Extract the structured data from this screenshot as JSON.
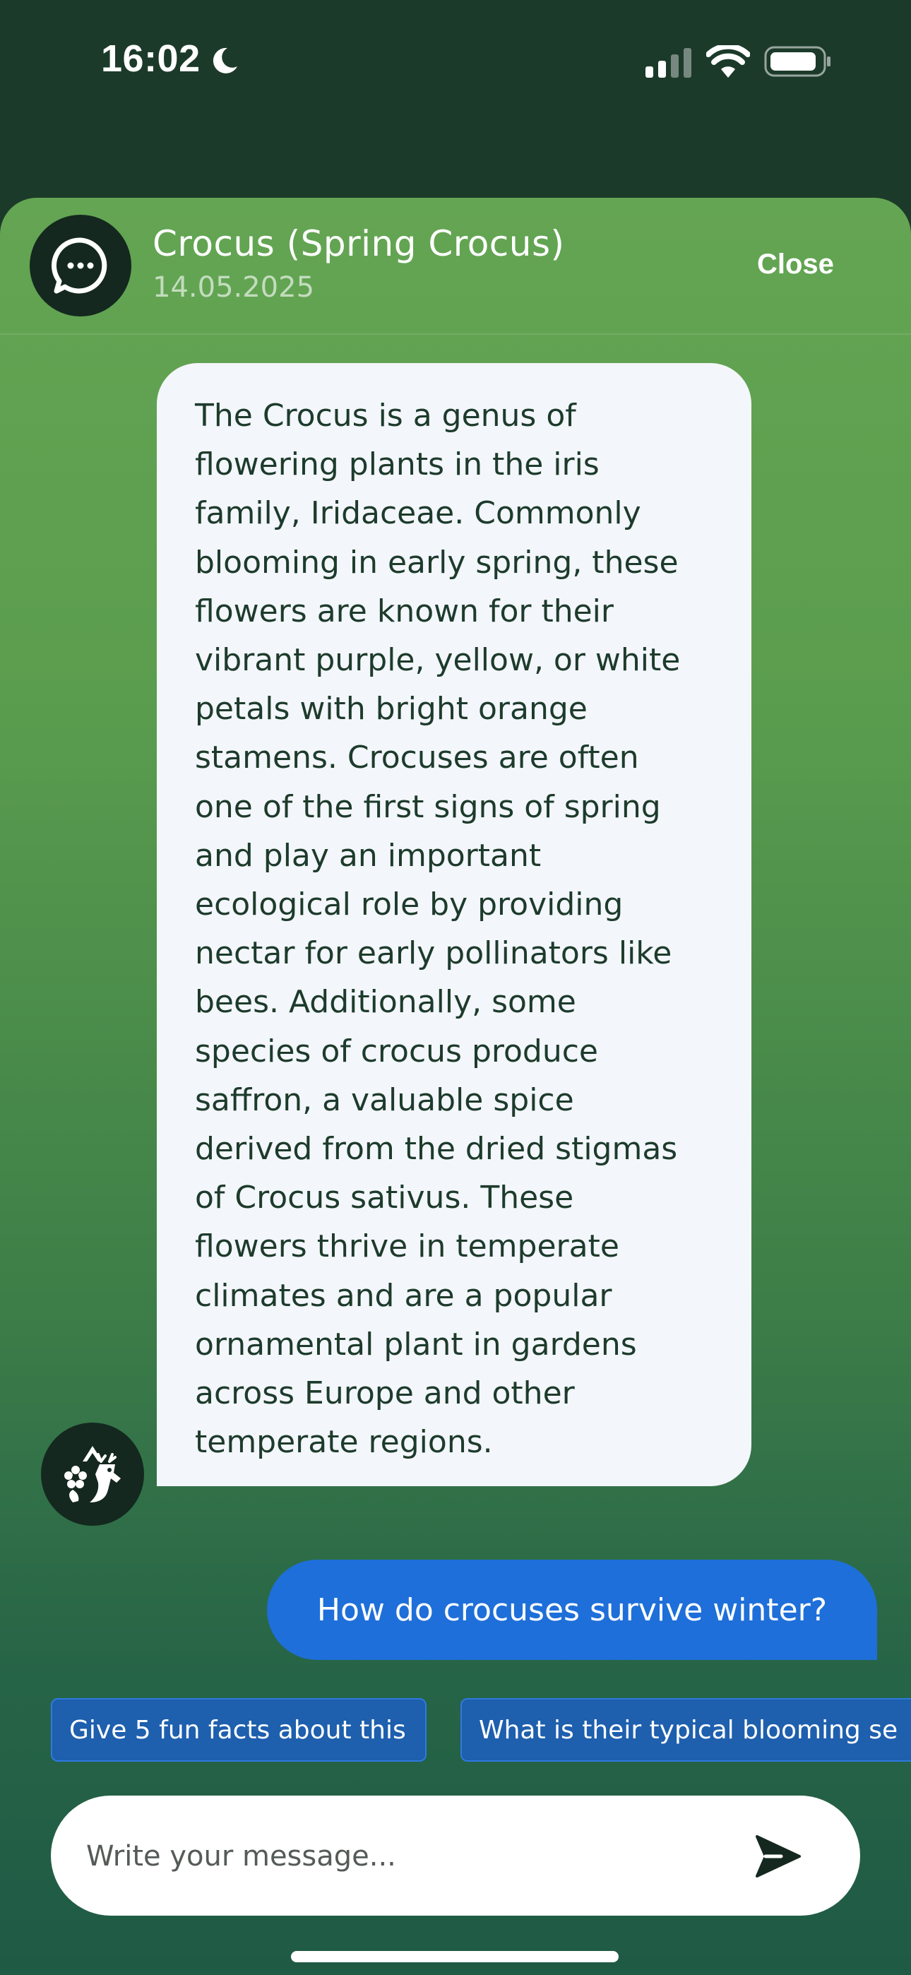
{
  "status_bar": {
    "time": "16:02"
  },
  "header": {
    "title": "Crocus (Spring Crocus)",
    "date": "14.05.2025",
    "close_label": "Close"
  },
  "messages": [
    {
      "role": "assistant",
      "text": "The Crocus is a genus of\nflowering plants in the iris\nfamily, Iridaceae. Commonly\nblooming in early spring, these\nflowers are known for their\nvibrant purple, yellow, or white\npetals with bright orange\nstamens. Crocuses are often\none of the first signs of spring\nand play an important\necological role by providing\nnectar for early pollinators like\nbees. Additionally, some\nspecies of crocus produce\nsaffron, a valuable spice\nderived from the dried stigmas\nof Crocus sativus. These\nflowers thrive in temperate\nclimates and are a popular\nornamental plant in gardens\nacross Europe and other\ntemperate regions."
    },
    {
      "role": "user",
      "text": "How do crocuses survive winter?"
    }
  ],
  "suggestions": [
    "Give 5 fun facts about this",
    "What is their typical blooming se"
  ],
  "composer": {
    "placeholder": "Write your message..."
  },
  "colors": {
    "sheet_top": "#64a553",
    "sheet_bottom": "#1f5a45",
    "bot_bubble": "#f3f6fa",
    "user_bubble": "#1e6fd9",
    "suggestion_chip": "#1e5fae",
    "avatar_bg": "#14281f"
  },
  "icons": [
    "moon-icon",
    "cellular-signal-icon",
    "wifi-icon",
    "battery-icon",
    "chat-bubble-icon",
    "nature-deer-flower-icon",
    "send-icon"
  ]
}
